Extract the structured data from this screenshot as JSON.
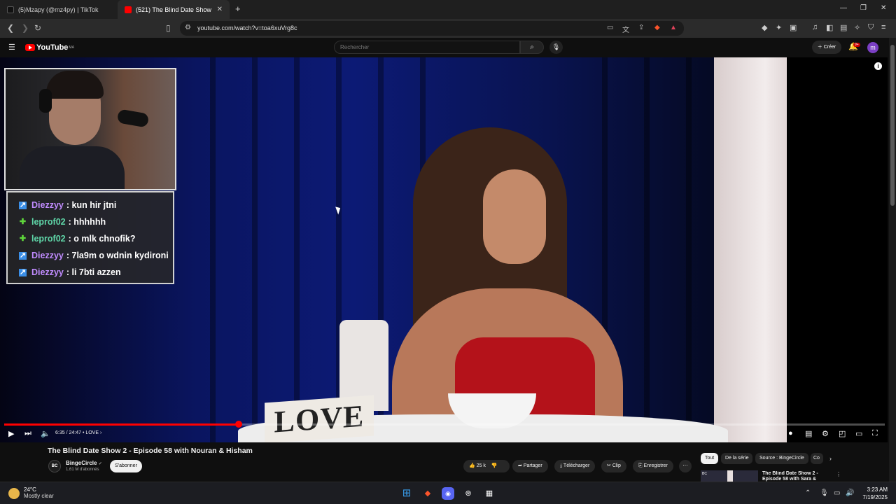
{
  "browser": {
    "tabs": [
      {
        "title": "(5)Mzapy (@mz4py) | TikTok",
        "active": false
      },
      {
        "title": "(521) The Blind Date Show 2 - Ep",
        "active": true
      }
    ],
    "new_tab": "+",
    "url": "youtube.com/watch?v=toa6xuVrg8c",
    "window_controls": {
      "minimize": "—",
      "maximize": "❐",
      "close": "✕"
    }
  },
  "youtube": {
    "logo": "YouTube",
    "region": "MA",
    "search_placeholder": "Rechercher",
    "create_label": "Créer",
    "notifications": "9+",
    "avatar_letter": "m"
  },
  "overlay": {
    "chat": [
      {
        "user": "Diezzyy",
        "message": ": kun hir jtni",
        "user_color": "#c18cff",
        "badge": "prime"
      },
      {
        "user": "leprof02",
        "message": ": hhhhhh",
        "user_color": "#5fd6a8",
        "badge": "mod"
      },
      {
        "user": "leprof02",
        "message": ": o mlk chnofik?",
        "user_color": "#5fd6a8",
        "badge": "mod"
      },
      {
        "user": "Diezzyy",
        "message": ": 7la9m o wdnin kydironi",
        "user_color": "#c18cff",
        "badge": "prime"
      },
      {
        "user": "Diezzyy",
        "message": ": li 7bti azzen",
        "user_color": "#c18cff",
        "badge": "prime"
      }
    ]
  },
  "video": {
    "sign_text": "LOVE",
    "time_current": "6:35",
    "time_total": "24:47",
    "chapter": "LOVE",
    "progress_fraction": 0.266,
    "title": "The Blind Date Show 2 - Episode 58 with Nouran & Hisham"
  },
  "channel": {
    "name": "BingeCircle",
    "verified": "✓",
    "subscribers": "1,61 M d'abonnés",
    "avatar_text": "BC",
    "subscribe_label": "S'abonner"
  },
  "actions": {
    "likes": "25 k",
    "share": "Partager",
    "download": "Télécharger",
    "clip": "Clip",
    "save": "Enregistrer",
    "more": "⋯"
  },
  "chips": [
    "Tout",
    "De la série",
    "Source : BingeCircle",
    "Co"
  ],
  "recommendation": {
    "title": "The Blind Date Show 2 - Episode 58 with Sara &"
  },
  "taskbar": {
    "temp": "24°C",
    "condition": "Mostly clear",
    "time": "3:23 AM",
    "date": "7/19/2025"
  },
  "colors": {
    "youtube_red": "#ff0000",
    "accent_purple": "#7b3fc4"
  }
}
